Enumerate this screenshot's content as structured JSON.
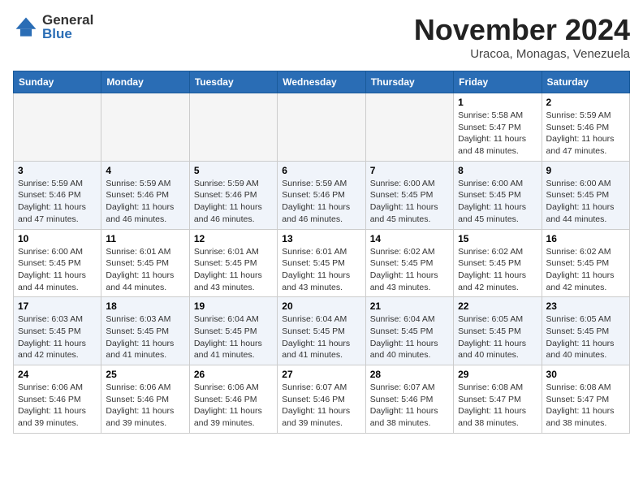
{
  "logo": {
    "general": "General",
    "blue": "Blue"
  },
  "header": {
    "month": "November 2024",
    "location": "Uracoa, Monagas, Venezuela"
  },
  "weekdays": [
    "Sunday",
    "Monday",
    "Tuesday",
    "Wednesday",
    "Thursday",
    "Friday",
    "Saturday"
  ],
  "weeks": [
    [
      {
        "day": "",
        "info": ""
      },
      {
        "day": "",
        "info": ""
      },
      {
        "day": "",
        "info": ""
      },
      {
        "day": "",
        "info": ""
      },
      {
        "day": "",
        "info": ""
      },
      {
        "day": "1",
        "info": "Sunrise: 5:58 AM\nSunset: 5:47 PM\nDaylight: 11 hours\nand 48 minutes."
      },
      {
        "day": "2",
        "info": "Sunrise: 5:59 AM\nSunset: 5:46 PM\nDaylight: 11 hours\nand 47 minutes."
      }
    ],
    [
      {
        "day": "3",
        "info": "Sunrise: 5:59 AM\nSunset: 5:46 PM\nDaylight: 11 hours\nand 47 minutes."
      },
      {
        "day": "4",
        "info": "Sunrise: 5:59 AM\nSunset: 5:46 PM\nDaylight: 11 hours\nand 46 minutes."
      },
      {
        "day": "5",
        "info": "Sunrise: 5:59 AM\nSunset: 5:46 PM\nDaylight: 11 hours\nand 46 minutes."
      },
      {
        "day": "6",
        "info": "Sunrise: 5:59 AM\nSunset: 5:46 PM\nDaylight: 11 hours\nand 46 minutes."
      },
      {
        "day": "7",
        "info": "Sunrise: 6:00 AM\nSunset: 5:45 PM\nDaylight: 11 hours\nand 45 minutes."
      },
      {
        "day": "8",
        "info": "Sunrise: 6:00 AM\nSunset: 5:45 PM\nDaylight: 11 hours\nand 45 minutes."
      },
      {
        "day": "9",
        "info": "Sunrise: 6:00 AM\nSunset: 5:45 PM\nDaylight: 11 hours\nand 44 minutes."
      }
    ],
    [
      {
        "day": "10",
        "info": "Sunrise: 6:00 AM\nSunset: 5:45 PM\nDaylight: 11 hours\nand 44 minutes."
      },
      {
        "day": "11",
        "info": "Sunrise: 6:01 AM\nSunset: 5:45 PM\nDaylight: 11 hours\nand 44 minutes."
      },
      {
        "day": "12",
        "info": "Sunrise: 6:01 AM\nSunset: 5:45 PM\nDaylight: 11 hours\nand 43 minutes."
      },
      {
        "day": "13",
        "info": "Sunrise: 6:01 AM\nSunset: 5:45 PM\nDaylight: 11 hours\nand 43 minutes."
      },
      {
        "day": "14",
        "info": "Sunrise: 6:02 AM\nSunset: 5:45 PM\nDaylight: 11 hours\nand 43 minutes."
      },
      {
        "day": "15",
        "info": "Sunrise: 6:02 AM\nSunset: 5:45 PM\nDaylight: 11 hours\nand 42 minutes."
      },
      {
        "day": "16",
        "info": "Sunrise: 6:02 AM\nSunset: 5:45 PM\nDaylight: 11 hours\nand 42 minutes."
      }
    ],
    [
      {
        "day": "17",
        "info": "Sunrise: 6:03 AM\nSunset: 5:45 PM\nDaylight: 11 hours\nand 42 minutes."
      },
      {
        "day": "18",
        "info": "Sunrise: 6:03 AM\nSunset: 5:45 PM\nDaylight: 11 hours\nand 41 minutes."
      },
      {
        "day": "19",
        "info": "Sunrise: 6:04 AM\nSunset: 5:45 PM\nDaylight: 11 hours\nand 41 minutes."
      },
      {
        "day": "20",
        "info": "Sunrise: 6:04 AM\nSunset: 5:45 PM\nDaylight: 11 hours\nand 41 minutes."
      },
      {
        "day": "21",
        "info": "Sunrise: 6:04 AM\nSunset: 5:45 PM\nDaylight: 11 hours\nand 40 minutes."
      },
      {
        "day": "22",
        "info": "Sunrise: 6:05 AM\nSunset: 5:45 PM\nDaylight: 11 hours\nand 40 minutes."
      },
      {
        "day": "23",
        "info": "Sunrise: 6:05 AM\nSunset: 5:45 PM\nDaylight: 11 hours\nand 40 minutes."
      }
    ],
    [
      {
        "day": "24",
        "info": "Sunrise: 6:06 AM\nSunset: 5:46 PM\nDaylight: 11 hours\nand 39 minutes."
      },
      {
        "day": "25",
        "info": "Sunrise: 6:06 AM\nSunset: 5:46 PM\nDaylight: 11 hours\nand 39 minutes."
      },
      {
        "day": "26",
        "info": "Sunrise: 6:06 AM\nSunset: 5:46 PM\nDaylight: 11 hours\nand 39 minutes."
      },
      {
        "day": "27",
        "info": "Sunrise: 6:07 AM\nSunset: 5:46 PM\nDaylight: 11 hours\nand 39 minutes."
      },
      {
        "day": "28",
        "info": "Sunrise: 6:07 AM\nSunset: 5:46 PM\nDaylight: 11 hours\nand 38 minutes."
      },
      {
        "day": "29",
        "info": "Sunrise: 6:08 AM\nSunset: 5:47 PM\nDaylight: 11 hours\nand 38 minutes."
      },
      {
        "day": "30",
        "info": "Sunrise: 6:08 AM\nSunset: 5:47 PM\nDaylight: 11 hours\nand 38 minutes."
      }
    ]
  ]
}
